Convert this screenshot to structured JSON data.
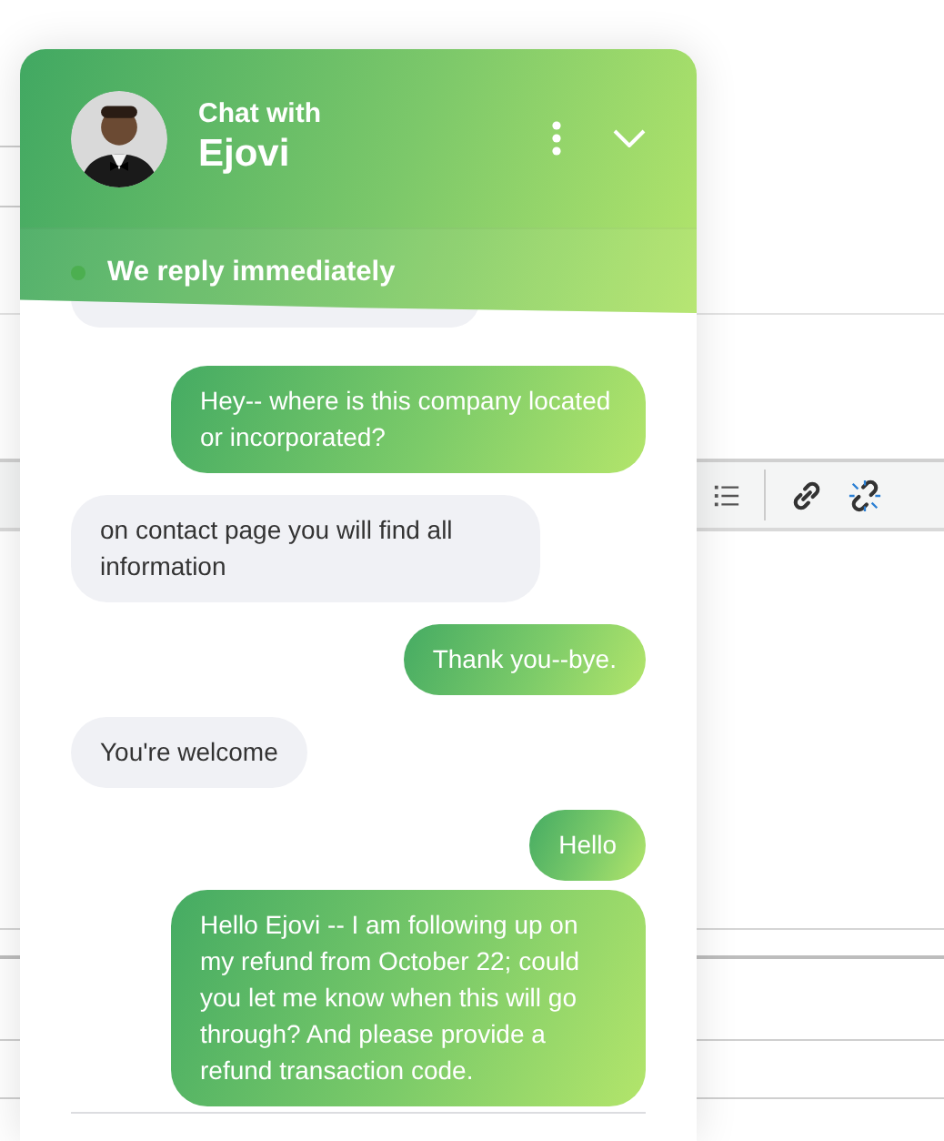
{
  "chat": {
    "title": "Chat with",
    "agent_name": "Ejovi",
    "status": {
      "text": "We reply immediately",
      "online": true
    },
    "messages": [
      {
        "kind": "sent",
        "text": "Hey-- where is this company located or incorporated?"
      },
      {
        "kind": "received",
        "text": "on contact page you will find all information"
      },
      {
        "kind": "sent",
        "text": "Thank you--bye."
      },
      {
        "kind": "received",
        "text": "You're welcome"
      },
      {
        "kind": "sent",
        "text": "Hello"
      },
      {
        "kind": "sent",
        "text": "Hello Ejovi -- I am following up on my refund from October 22; could you let me know when this will go through? And please provide a refund transaction code."
      }
    ]
  }
}
